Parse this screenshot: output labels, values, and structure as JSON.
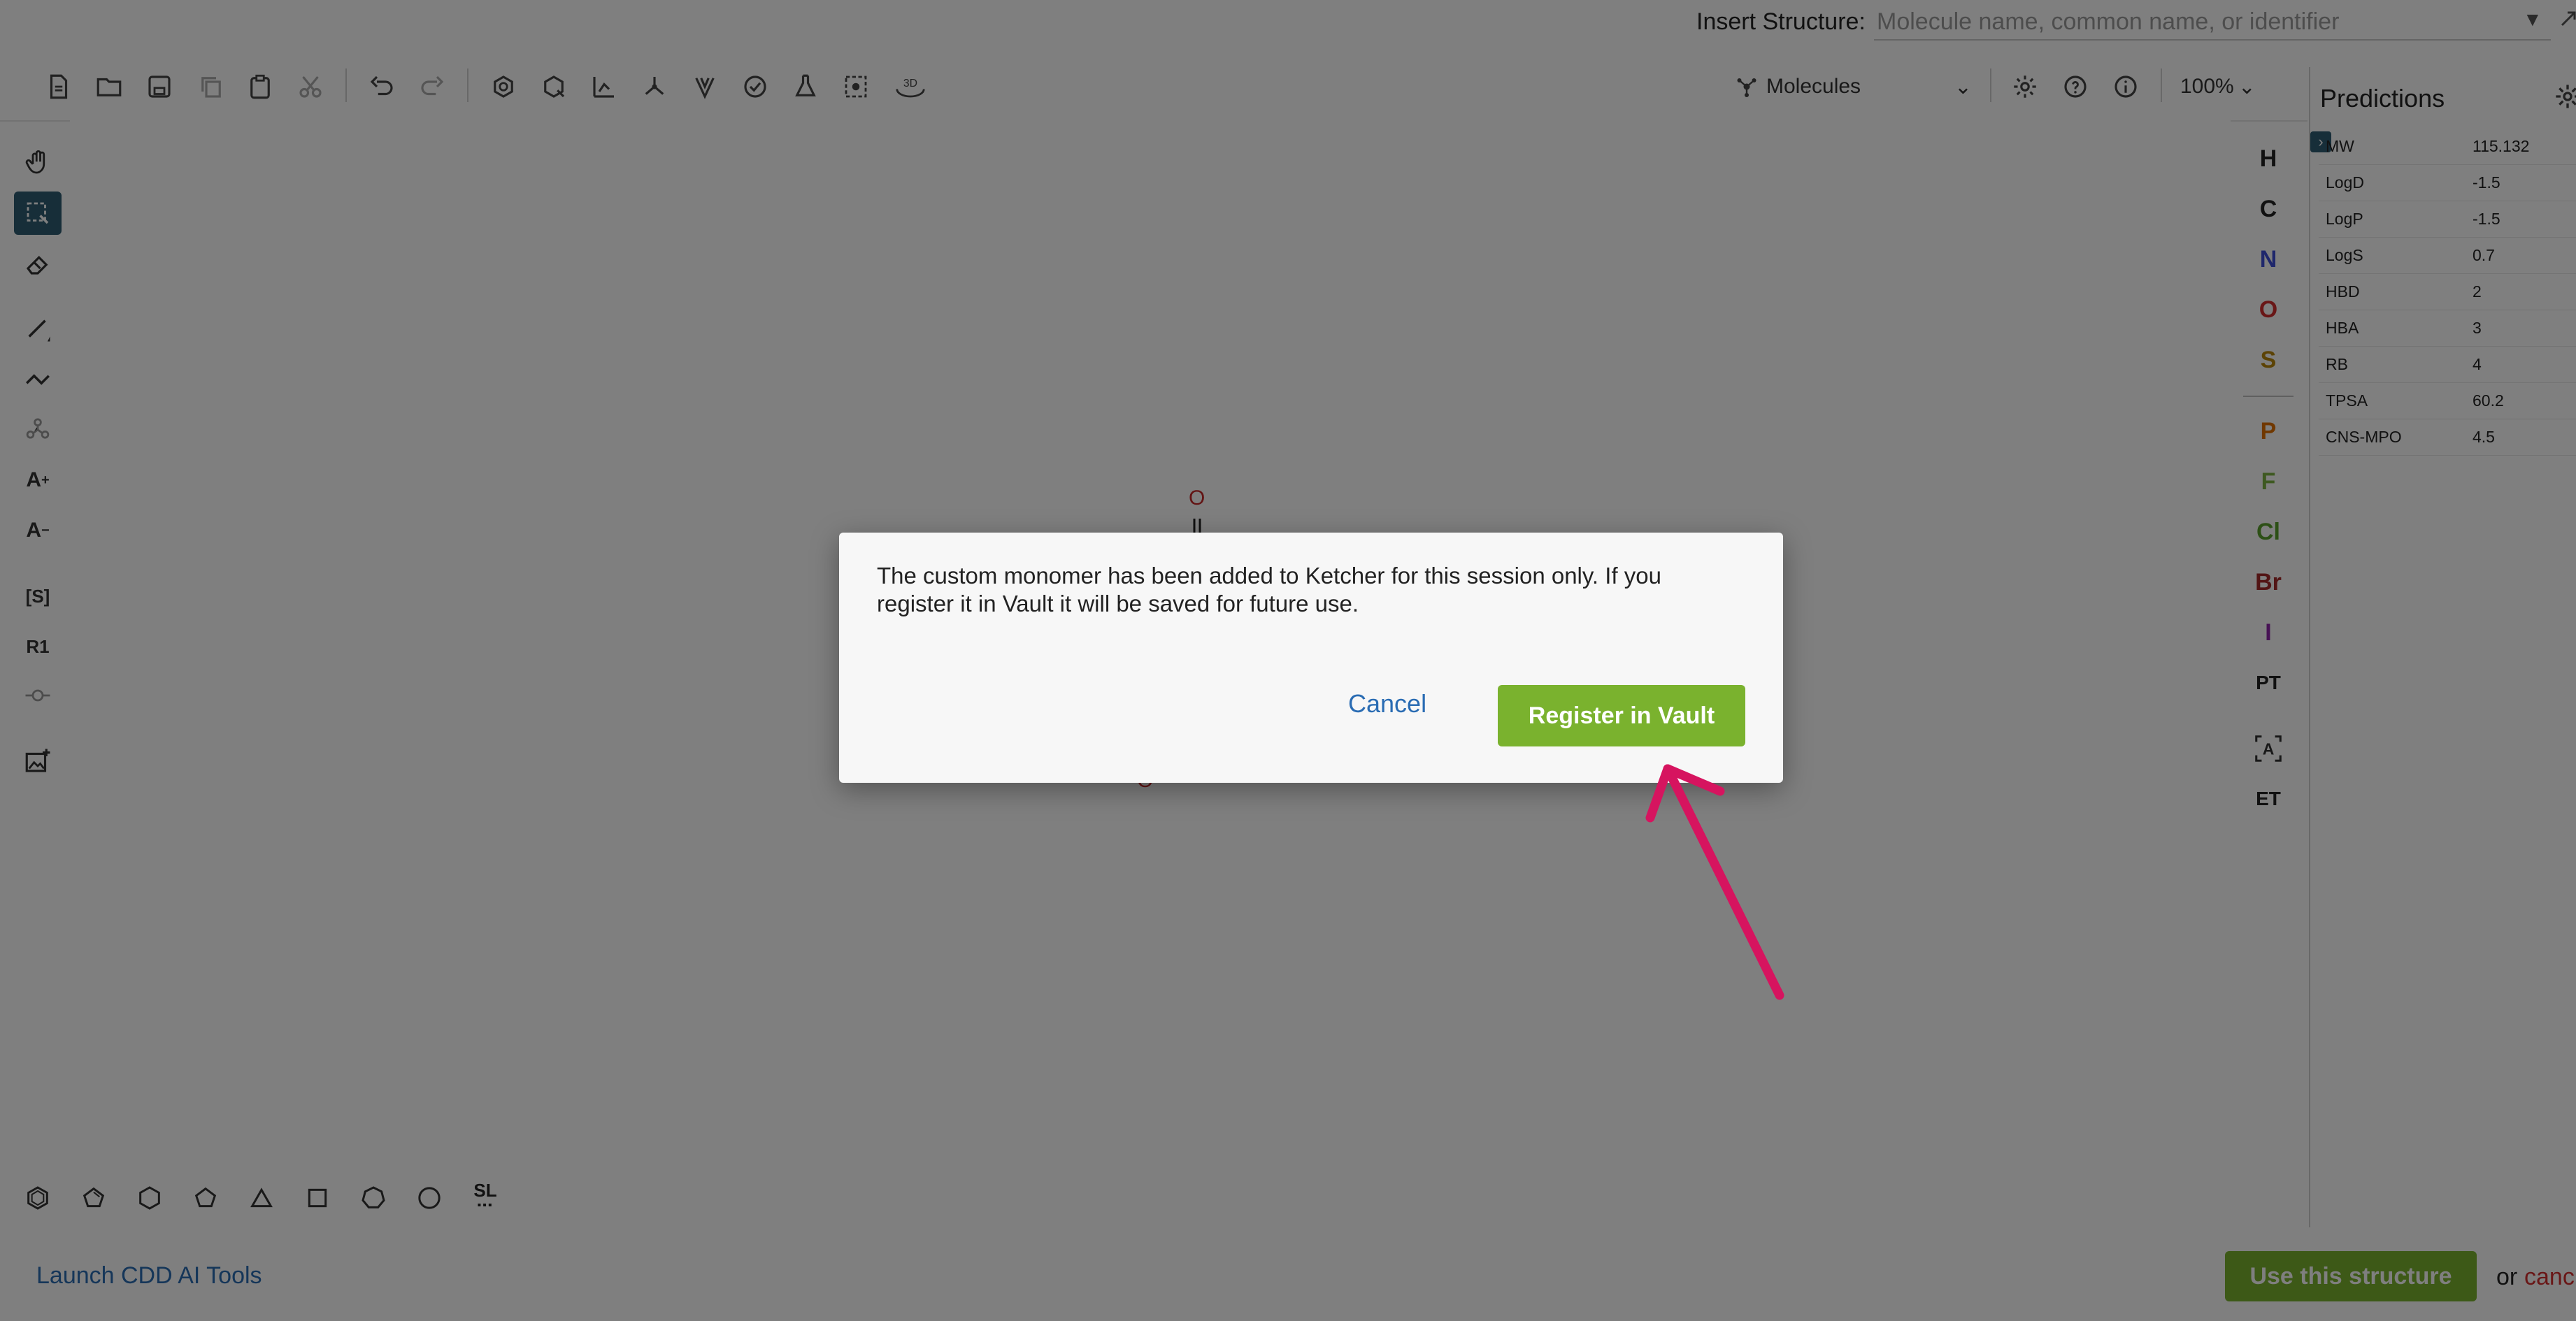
{
  "insert_bar": {
    "label": "Insert Structure:",
    "placeholder": "Molecule name, common name, or identifier"
  },
  "toolbar": {
    "mode_label": "Molecules",
    "zoom_label": "100%",
    "threed_label": "3D"
  },
  "left_toolbar": {
    "sgroup_label": "[S]",
    "rgroup_label": "R1"
  },
  "canvas": {
    "atoms": [
      "O",
      "O"
    ]
  },
  "atom_panel": {
    "atoms": [
      "H",
      "C",
      "N",
      "O",
      "S",
      "P",
      "F",
      "Cl",
      "Br",
      "I"
    ],
    "periodic_label": "PT",
    "extended_label": "ET",
    "colors": {
      "H": "#222222",
      "C": "#222222",
      "N": "#3f4fd8",
      "O": "#d32f2f",
      "S": "#b8860b",
      "P": "#e07000",
      "F": "#7cb342",
      "Cl": "#5aa02c",
      "Br": "#a52a2a",
      "I": "#8e24aa"
    }
  },
  "predictions": {
    "title": "Predictions",
    "rows": [
      {
        "key": "MW",
        "value": "115.132"
      },
      {
        "key": "LogD",
        "value": "-1.5"
      },
      {
        "key": "LogP",
        "value": "-1.5"
      },
      {
        "key": "LogS",
        "value": "0.7"
      },
      {
        "key": "HBD",
        "value": "2"
      },
      {
        "key": "HBA",
        "value": "3"
      },
      {
        "key": "RB",
        "value": "4"
      },
      {
        "key": "TPSA",
        "value": "60.2"
      },
      {
        "key": "CNS-MPO",
        "value": "4.5"
      }
    ]
  },
  "bottom_toolbar": {
    "sl_label": "SL"
  },
  "footer": {
    "launch_label": "Launch CDD AI Tools",
    "use_label": "Use this structure",
    "or_label": "or",
    "cancel_label": "canc"
  },
  "dialog": {
    "message": "The custom monomer has been added to Ketcher for this session only. If you register it in Vault it will be saved for future use.",
    "cancel_label": "Cancel",
    "register_label": "Register in Vault"
  },
  "colors": {
    "accent_green": "#7ab22e",
    "link_blue": "#2a6cb3",
    "annotation_arrow": "#d6145f",
    "active_tool": "#2f5c73"
  }
}
